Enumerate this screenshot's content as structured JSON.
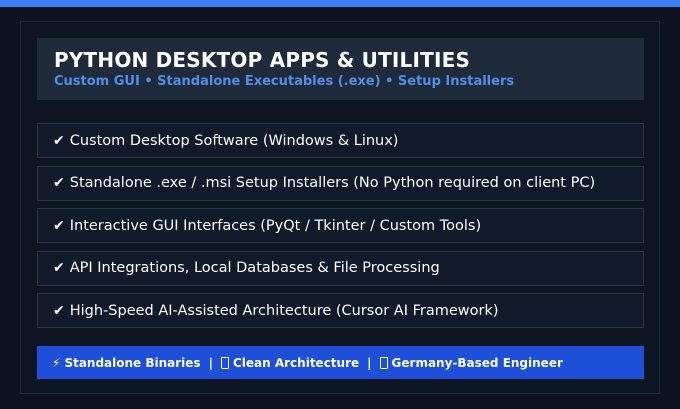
{
  "header": {
    "title": "PYTHON DESKTOP APPS & UTILITIES",
    "subtitle": "Custom GUI • Standalone Executables (.exe) • Setup Installers"
  },
  "features": [
    {
      "check": "✔",
      "label": "Custom Desktop Software (Windows & Linux)"
    },
    {
      "check": "✔",
      "label": "Standalone .exe / .msi Setup Installers (No Python required on client PC)"
    },
    {
      "check": "✔",
      "label": "Interactive GUI Interfaces (PyQt / Tkinter / Custom Tools)"
    },
    {
      "check": "✔",
      "label": "API Integrations, Local Databases & File Processing"
    },
    {
      "check": "✔",
      "label": "High-Speed AI-Assisted Architecture (Cursor AI Framework)"
    }
  ],
  "footer": {
    "item1_icon": "⚡",
    "item1": "Standalone Binaries",
    "separator": "|",
    "item2": "Clean Architecture",
    "item3": "Germany-Based Engineer"
  },
  "colors": {
    "accent": "#3b82f6",
    "subtitle": "#4f8fe6",
    "footer_bg": "#1e4fd8",
    "background": "#0c1220"
  }
}
